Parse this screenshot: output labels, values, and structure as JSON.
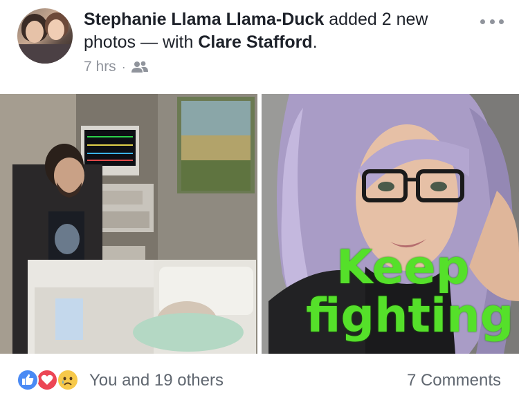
{
  "post": {
    "author": "Stephanie Llama Llama-Duck",
    "action_text": "added 2 new photos — with",
    "tagged": "Clare Stafford",
    "period": ".",
    "timestamp": "7 hrs",
    "separator": "·",
    "audience_icon": "friends-icon",
    "more_icon": "more-options-icon"
  },
  "photos": [
    {
      "alt_icon": "photo"
    },
    {
      "caption_line1": "Keep",
      "caption_line2": "fighting"
    }
  ],
  "reactions": {
    "icons": [
      "like-icon",
      "love-icon",
      "sad-icon"
    ],
    "summary": "You and 19 others",
    "comments": "7 Comments"
  },
  "colors": {
    "name_text": "#1d2129",
    "meta_text": "#90949c",
    "like_blue": "#4a8af4",
    "love_red": "#ec4655",
    "sad_yellow": "#f7c94a",
    "caption_green": "#55e02a"
  }
}
